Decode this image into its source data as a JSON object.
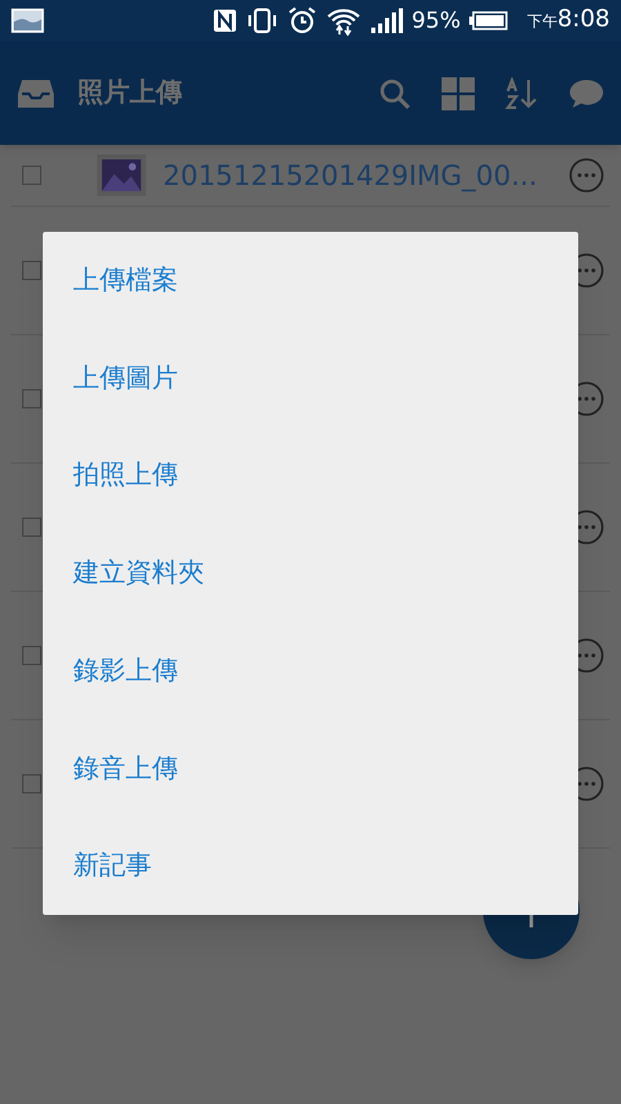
{
  "status_bar": {
    "battery": "95%",
    "time_prefix": "下午",
    "time": "8:08"
  },
  "app_bar": {
    "title": "照片上傳"
  },
  "files": [
    {
      "name": "20151215201429IMG_00...",
      "checked": false
    },
    {
      "checked": false
    },
    {
      "checked": false
    },
    {
      "checked": false
    },
    {
      "checked": false
    },
    {
      "checked": false
    }
  ],
  "menu": {
    "items": [
      {
        "label": "上傳檔案"
      },
      {
        "label": "上傳圖片"
      },
      {
        "label": "拍照上傳"
      },
      {
        "label": "建立資料夾"
      },
      {
        "label": "錄影上傳"
      },
      {
        "label": "錄音上傳"
      },
      {
        "label": "新記事"
      }
    ]
  }
}
